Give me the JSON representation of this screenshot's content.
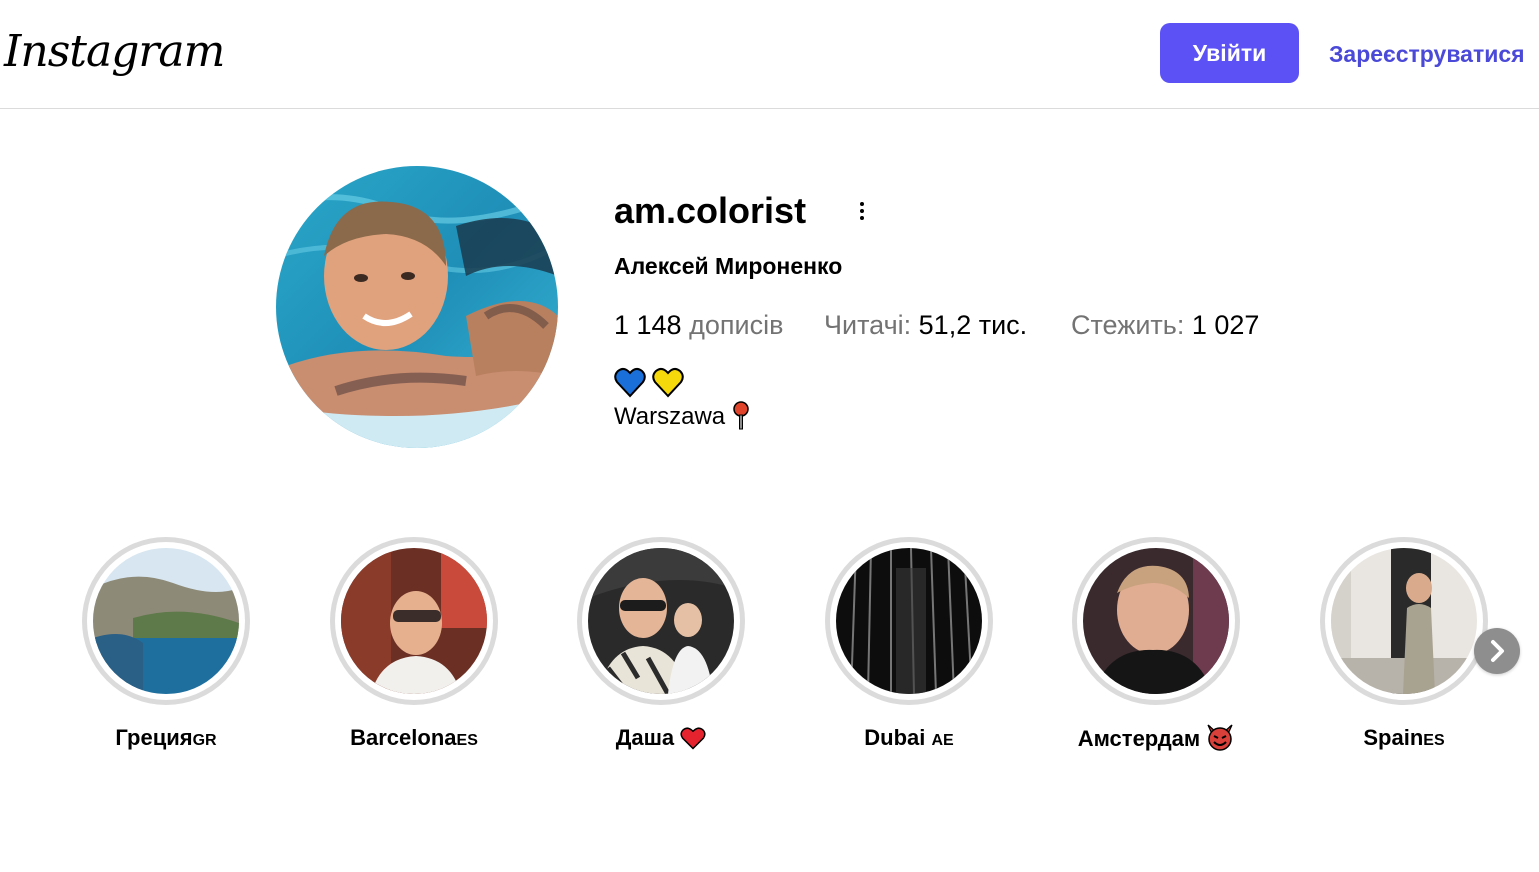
{
  "header": {
    "logo_text": "Instagram",
    "login_label": "Увійти",
    "signup_label": "Зареєструватися"
  },
  "colors": {
    "primary_button": "#5b51f5",
    "link": "#4a49d8",
    "secondary_text": "#737373"
  },
  "profile": {
    "username": "am.colorist",
    "full_name": "Алексей Мироненко",
    "posts_count": "1 148",
    "posts_label": "дописів",
    "followers_label": "Читачі:",
    "followers_count": "51,2 тис.",
    "following_label": "Стежить:",
    "following_count": "1 027",
    "bio_hearts": [
      "blue-heart",
      "yellow-heart"
    ],
    "bio_location": "Warszawa",
    "bio_location_icon": "round-pushpin"
  },
  "highlights": [
    {
      "title": "Греция",
      "flag": "GR"
    },
    {
      "title": "Barcelona",
      "flag": "ES"
    },
    {
      "title": "Даша",
      "emoji": "red-heart"
    },
    {
      "title": "Dubai ",
      "flag": "AE"
    },
    {
      "title": "Амстердам",
      "emoji": "smiling-devil"
    },
    {
      "title": "Spain",
      "flag": "ES"
    }
  ],
  "icons": {
    "more": "more-options-icon",
    "next": "chevron-right-icon"
  }
}
